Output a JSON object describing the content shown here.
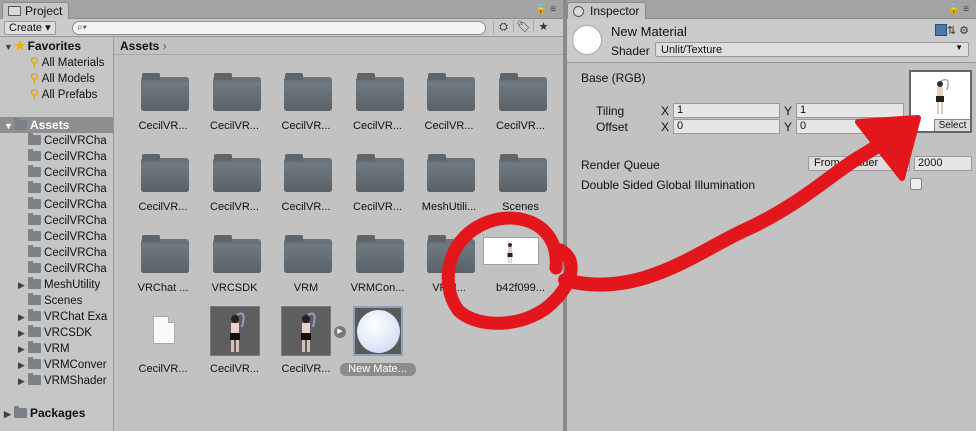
{
  "project": {
    "tab_label": "Project",
    "create_label": "Create",
    "search_placeholder": "",
    "tree": {
      "favorites_label": "Favorites",
      "favorites": [
        "All Materials",
        "All Models",
        "All Prefabs"
      ],
      "assets_label": "Assets",
      "asset_folders": [
        "CecilVRCha",
        "CecilVRCha",
        "CecilVRCha",
        "CecilVRCha",
        "CecilVRCha",
        "CecilVRCha",
        "CecilVRCha",
        "CecilVRCha",
        "CecilVRCha",
        "MeshUtility",
        "Scenes",
        "VRChat Exa",
        "VRCSDK",
        "VRM",
        "VRMConver",
        "VRMShader"
      ],
      "packages_label": "Packages"
    },
    "breadcrumb": "Assets",
    "assets": [
      {
        "label": "CecilVR...",
        "kind": "folder"
      },
      {
        "label": "CecilVR...",
        "kind": "folder"
      },
      {
        "label": "CecilVR...",
        "kind": "folder"
      },
      {
        "label": "CecilVR...",
        "kind": "folder"
      },
      {
        "label": "CecilVR...",
        "kind": "folder"
      },
      {
        "label": "CecilVR...",
        "kind": "folder"
      },
      {
        "label": "CecilVR...",
        "kind": "folder"
      },
      {
        "label": "CecilVR...",
        "kind": "folder"
      },
      {
        "label": "CecilVR...",
        "kind": "folder"
      },
      {
        "label": "CecilVR...",
        "kind": "folder"
      },
      {
        "label": "MeshUtili...",
        "kind": "folder"
      },
      {
        "label": "Scenes",
        "kind": "folder"
      },
      {
        "label": "VRChat ...",
        "kind": "folder"
      },
      {
        "label": "VRCSDK",
        "kind": "folder"
      },
      {
        "label": "VRM",
        "kind": "folder"
      },
      {
        "label": "VRMCon...",
        "kind": "folder"
      },
      {
        "label": "VRM...",
        "kind": "folder"
      },
      {
        "label": "b42f099...",
        "kind": "texture"
      },
      {
        "label": "CecilVR...",
        "kind": "file"
      },
      {
        "label": "CecilVR...",
        "kind": "model"
      },
      {
        "label": "CecilVR...",
        "kind": "model"
      },
      {
        "label": "New Mate...",
        "kind": "material"
      }
    ]
  },
  "inspector": {
    "tab_label": "Inspector",
    "material_name": "New Material",
    "shader_label": "Shader",
    "shader_value": "Unlit/Texture",
    "base_label": "Base (RGB)",
    "tiling_label": "Tiling",
    "offset_label": "Offset",
    "x_label": "X",
    "y_label": "Y",
    "tiling_x": "1",
    "tiling_y": "1",
    "offset_x": "0",
    "offset_y": "0",
    "select_label": "Select",
    "render_queue_label": "Render Queue",
    "render_queue_dropdown": "From Shader",
    "render_queue_value": "2000",
    "dsgi_label": "Double Sided Global Illumination"
  },
  "colors": {
    "panel_bg": "#c2c2c2",
    "annotation_red": "#e3171b",
    "selection": "#8e8e8e"
  }
}
